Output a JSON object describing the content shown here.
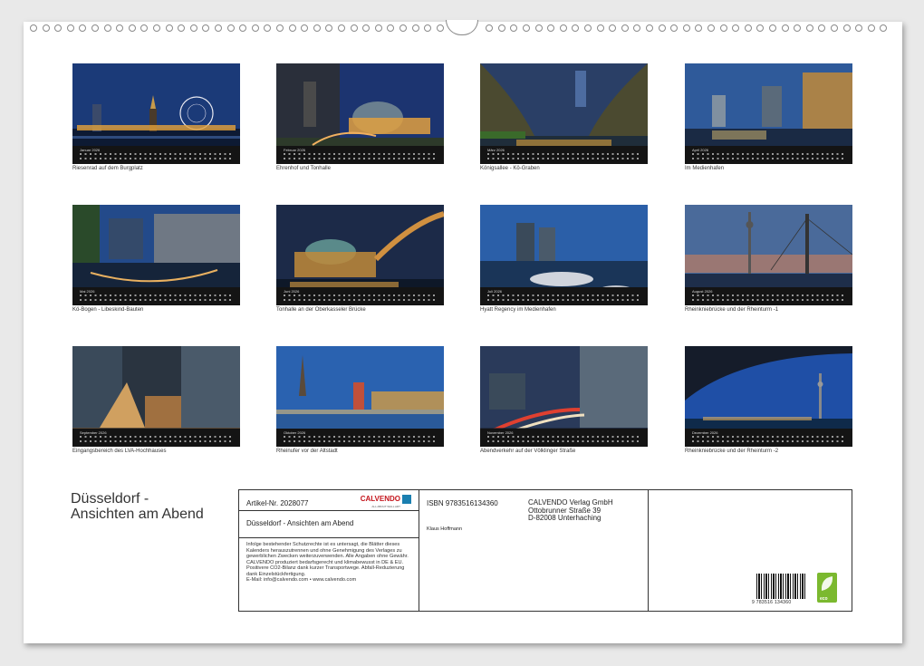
{
  "calendar": {
    "months": [
      {
        "month": "Januar 2026",
        "caption": "Riesenrad auf dem Burgplatz"
      },
      {
        "month": "Februar 2026",
        "caption": "Ehrenhof und Tonhalle"
      },
      {
        "month": "März 2026",
        "caption": "Königsallee - Kö-Graben"
      },
      {
        "month": "April 2026",
        "caption": "Im Medienhafen"
      },
      {
        "month": "Mai 2026",
        "caption": "Kö-Bogen - Libeskind-Bauten"
      },
      {
        "month": "Juni 2026",
        "caption": "Tonhalle an der Oberkasseler Brücke"
      },
      {
        "month": "Juli 2026",
        "caption": "Hyatt Regency im Medienhafen"
      },
      {
        "month": "August 2026",
        "caption": "Rheinkniebrücke und der Rheinturm -1"
      },
      {
        "month": "September 2026",
        "caption": "Eingangsbereich des LVA-Hochhauses"
      },
      {
        "month": "Oktober 2026",
        "caption": "Rheinufer vor der Altstadt"
      },
      {
        "month": "November 2026",
        "caption": "Abendverkehr auf der Völklinger Straße"
      },
      {
        "month": "Dezember 2026",
        "caption": "Rheinkniebrücke und der Rheinturm -2"
      }
    ]
  },
  "cover": {
    "title_line1": "Düsseldorf -",
    "title_line2": "Ansichten am Abend"
  },
  "info": {
    "artikel": "Artikel-Nr. 2028077",
    "logo": "CALVENDO",
    "logo_tag": "ALL ABOUT WALL ART",
    "subtitle": "Düsseldorf - Ansichten am Abend",
    "legal": "Infolge bestehender Schutzrechte ist es untersagt, die Blätter dieses Kalenders herauszutrennen und ohne Genehmigung des Verlages zu gewerblichen Zwecken weiterzuverwenden. Alle Angaben ohne Gewähr. CALVENDO produziert bedarfsgerecht und klimabewusst in DE & EU. Positivere CO2-Bilanz dank kurzer Transportwege. Abfall-Reduzierung dank Einzelstückfertigung.",
    "email": "E-Mail: info@calvendo.com • www.calvendo.com",
    "isbn": "ISBN 9783516134360",
    "author": "Klaus Hoffmann",
    "publisher_line1": "CALVENDO Verlag GmbH",
    "publisher_line2": "Ottobrunner Straße 39",
    "publisher_line3": "D-82008 Unterhaching",
    "barcode_number": "9 783516 134360",
    "eco_label": "eco"
  },
  "colors": {
    "photo_sky": "#1d3f7a",
    "photo_dark": "#0f1a2e",
    "calendar_strip": "#141414",
    "logo_red": "#c4151c",
    "eco_green": "#7bb92f"
  }
}
